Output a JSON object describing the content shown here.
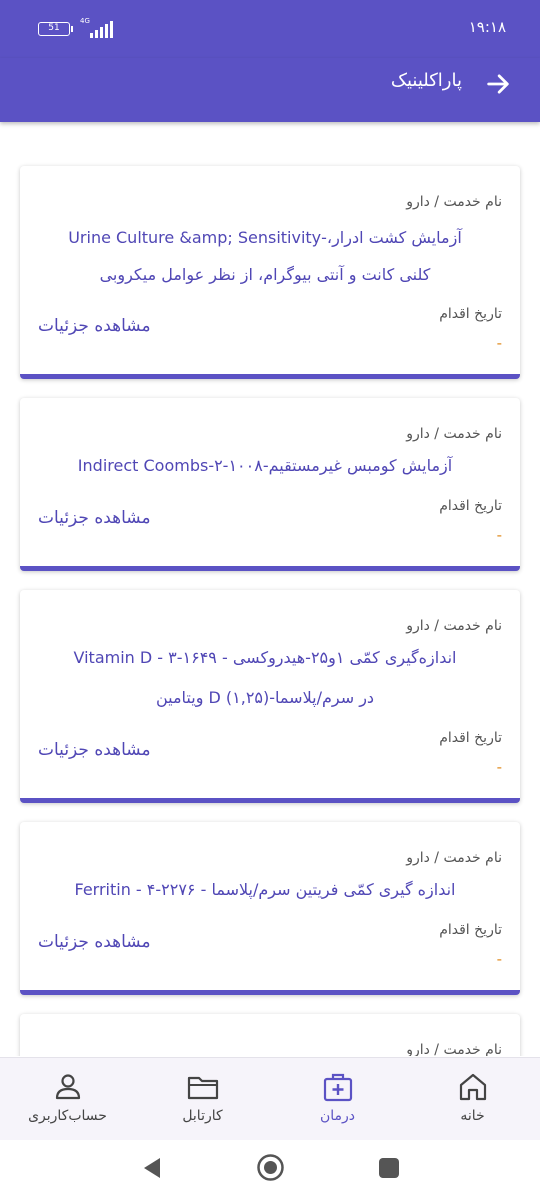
{
  "status_bar": {
    "battery": "51",
    "network": "4G",
    "time": "۱۹:۱۸"
  },
  "app_bar": {
    "title": "پاراکلینیک"
  },
  "cards": [
    {
      "service_label": "نام خدمت / دارو",
      "service_line1": "آزمایش کشت ادرار،-Urine Culture &amp; Sensitivity",
      "service_line2": "کلنی کانت و آنتی بیوگرام، از نظر عوامل میکروبی",
      "date_label": "تاریخ اقدام",
      "date_value": "-",
      "details": "مشاهده جزئیات"
    },
    {
      "service_label": "نام خدمت / دارو",
      "service_line1": "آزمایش کومبس غیرمستقیم-Indirect Coombs-۲-۱۰۰۸",
      "date_label": "تاریخ اقدام",
      "date_value": "-",
      "details": "مشاهده جزئیات"
    },
    {
      "service_label": "نام خدمت / دارو",
      "service_line1": "اندازه‌گیری کمّی ۱و۲۵-هیدروکسی -  Vitamin D - ۳-۱۶۴۹",
      "service_line2": "در سرم/پلاسما-(۱,۲۵) D ویتامین",
      "date_label": "تاریخ اقدام",
      "date_value": "-",
      "details": "مشاهده جزئیات"
    },
    {
      "service_label": "نام خدمت / دارو",
      "service_line1": "اندازه گیری کمّی فریتین سرم/پلاسما - Ferritin - ۴-۲۲۷۶",
      "date_label": "تاریخ اقدام",
      "date_value": "-",
      "details": "مشاهده جزئیات"
    },
    {
      "service_label": "نام خدمت / دارو"
    }
  ],
  "bottom_nav": {
    "home": "خانه",
    "treatment": "درمان",
    "cartable": "کارتابل",
    "account": "حساب‌کاربری",
    "active": "treatment"
  },
  "colors": {
    "primary": "#5b52c4",
    "link": "#5047b5",
    "date": "#e08a1e"
  },
  "icons": [
    "arrow-right-icon",
    "home-icon",
    "medical-kit-icon",
    "folder-icon",
    "person-icon",
    "back-triangle-icon",
    "home-circle-icon",
    "recents-square-icon"
  ]
}
